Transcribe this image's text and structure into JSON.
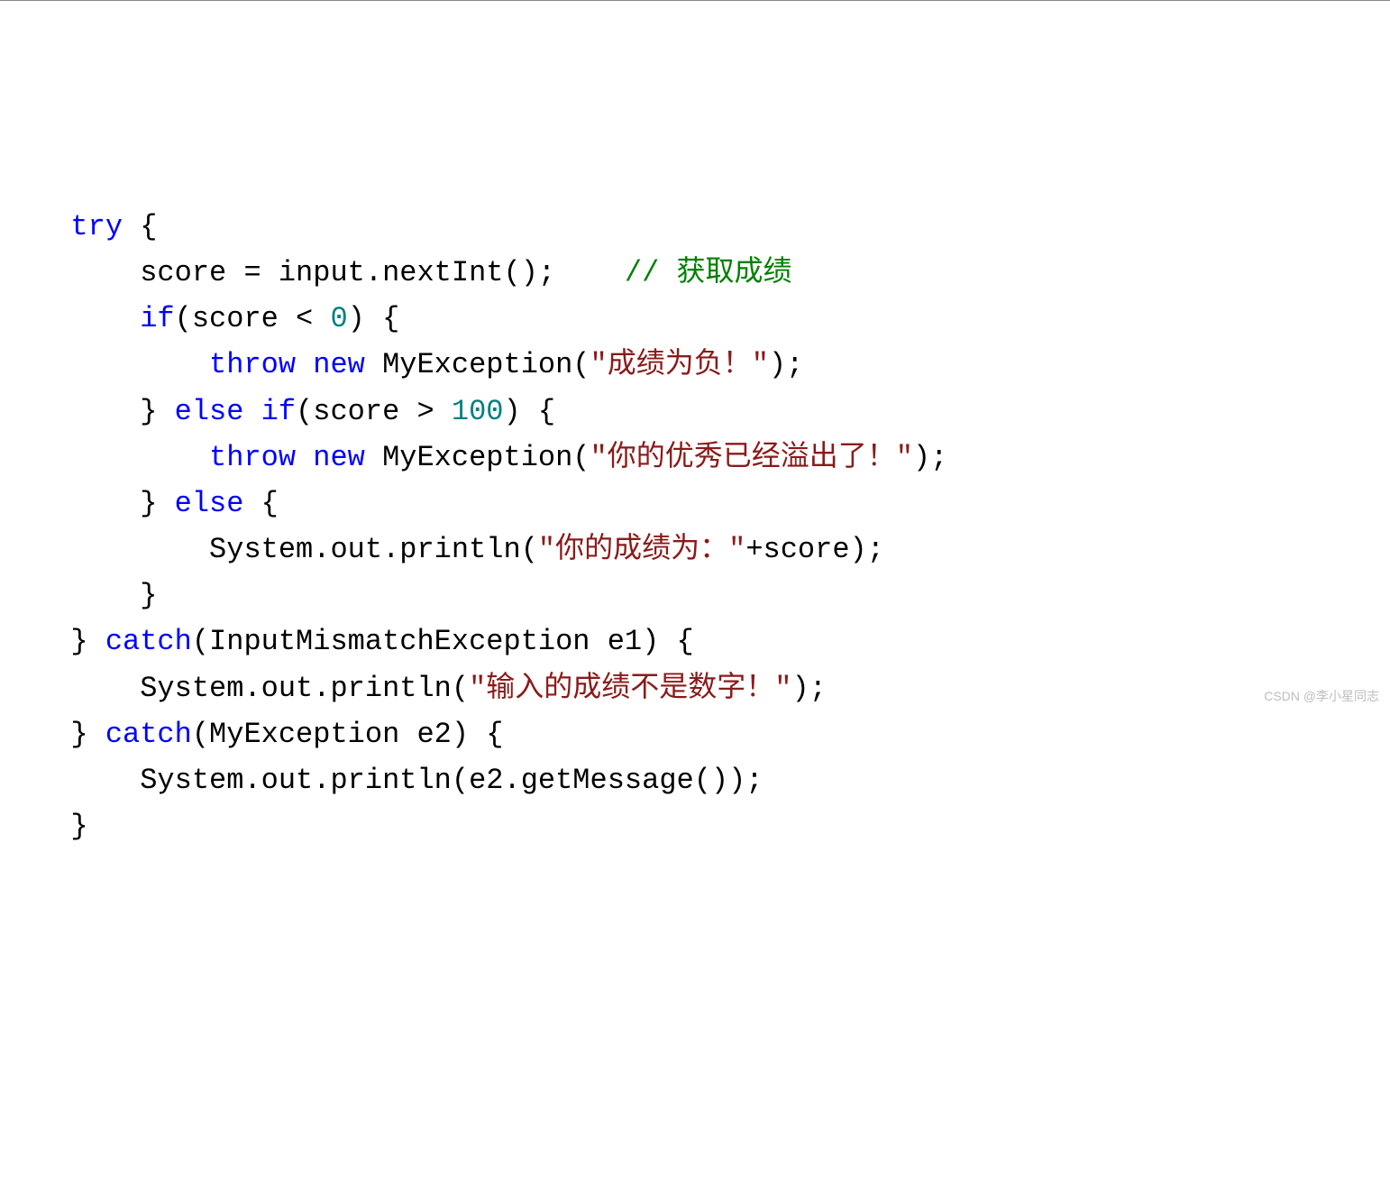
{
  "code": {
    "l1": {
      "t1": "  ",
      "kw": "try",
      "t2": " {"
    },
    "l2": {
      "t1": "      score = input.nextInt();    ",
      "cmt": "// 获取成绩"
    },
    "l3": {
      "t1": "      ",
      "kw": "if",
      "t2": "(score < ",
      "num": "0",
      "t3": ") {"
    },
    "l4": {
      "t1": "          ",
      "kw1": "throw",
      "sp": " ",
      "kw2": "new",
      "t2": " MyException(",
      "str": "\"成绩为负！\"",
      "t3": ");"
    },
    "l5": {
      "t1": "      } ",
      "kw1": "else",
      "sp": " ",
      "kw2": "if",
      "t2": "(score > ",
      "num": "100",
      "t3": ") {"
    },
    "l6": {
      "t1": "          ",
      "kw1": "throw",
      "sp": " ",
      "kw2": "new",
      "t2": " MyException(",
      "str": "\"你的优秀已经溢出了！\"",
      "t3": ");"
    },
    "l7": {
      "t1": "      } ",
      "kw": "else",
      "t2": " {"
    },
    "l8": {
      "t1": "          System.out.println(",
      "str": "\"你的成绩为：\"",
      "t2": "+score);"
    },
    "l9": {
      "t1": "      }"
    },
    "l10": {
      "t1": "  } ",
      "kw": "catch",
      "t2": "(InputMismatchException e1) {"
    },
    "l11": {
      "t1": "      System.out.println(",
      "str": "\"输入的成绩不是数字！\"",
      "t2": ");"
    },
    "l12": {
      "t1": "  } ",
      "kw": "catch",
      "t2": "(MyException e2) {"
    },
    "l13": {
      "t1": "      System.out.println(e2.getMessage());"
    },
    "l14": {
      "t1": "  }"
    }
  },
  "watermark": "CSDN @李小星同志"
}
